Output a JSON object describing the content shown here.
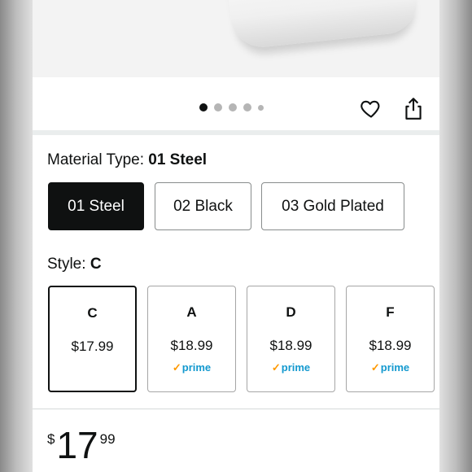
{
  "gallery": {
    "dots": [
      true,
      false,
      false,
      false,
      false
    ],
    "heart_icon": "heart-outline-icon",
    "share_icon": "share-icon"
  },
  "material": {
    "label": "Material Type: ",
    "selected": "01 Steel",
    "options": [
      "01 Steel",
      "02 Black",
      "03 Gold Plated"
    ]
  },
  "style": {
    "label": "Style: ",
    "selected": "C",
    "options": [
      {
        "letter": "C",
        "price": "$17.99",
        "prime": ""
      },
      {
        "letter": "A",
        "price": "$18.99",
        "prime": "prime"
      },
      {
        "letter": "D",
        "price": "$18.99",
        "prime": "prime"
      },
      {
        "letter": "F",
        "price": "$18.99",
        "prime": "prime"
      }
    ]
  },
  "price": {
    "currency": "$",
    "whole": "17",
    "fraction": "99"
  },
  "colors": {
    "selected_bg": "#0f1111",
    "prime_blue": "#1399cf",
    "prime_check": "#ff9900"
  }
}
